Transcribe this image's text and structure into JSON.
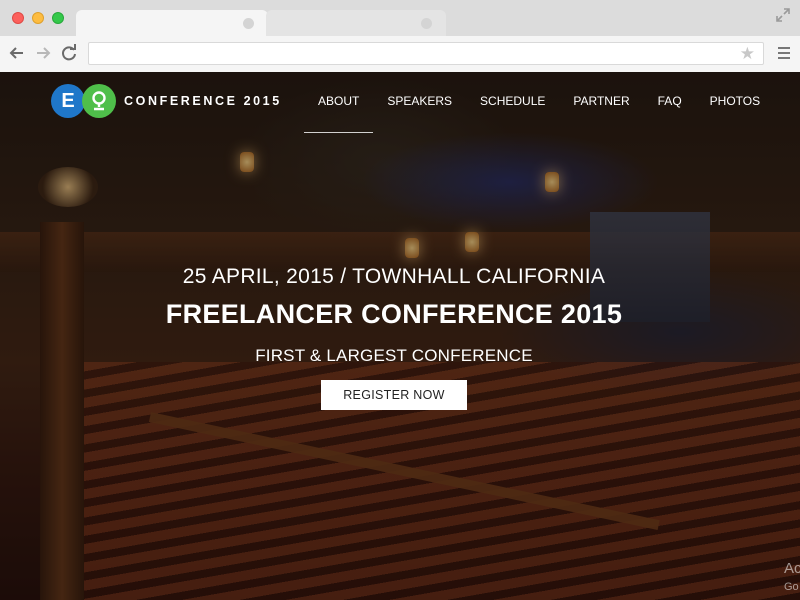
{
  "browser": {
    "url": "",
    "colors": {
      "close": "#fc605c",
      "minimize": "#fdbc40",
      "maximize": "#34c84a"
    },
    "icons": [
      "back-arrow-icon",
      "forward-arrow-icon",
      "reload-icon",
      "star-icon",
      "menu-icon",
      "expand-icon"
    ]
  },
  "site": {
    "logo_letter_e": "E",
    "logo_text": "CONFERENCE 2015",
    "colors": {
      "logo_blue": "#1f77c9",
      "logo_green": "#4fbf4a"
    },
    "nav": [
      {
        "label": "ABOUT",
        "active": true
      },
      {
        "label": "SPEAKERS"
      },
      {
        "label": "SCHEDULE"
      },
      {
        "label": "PARTNER"
      },
      {
        "label": "FAQ"
      },
      {
        "label": "PHOTOS"
      }
    ]
  },
  "hero": {
    "date_location": "25 APRIL, 2015 / TOWNHALL CALIFORNIA",
    "title": "FREELANCER CONFERENCE 2015",
    "subtitle": "FIRST & LARGEST CONFERENCE",
    "cta_label": "REGISTER NOW"
  },
  "watermark": {
    "line1": "Ac",
    "line2": "Go"
  }
}
